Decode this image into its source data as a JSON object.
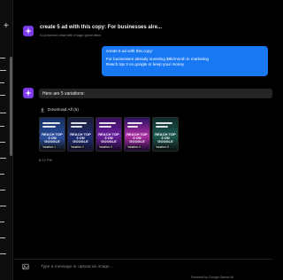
{
  "header": {
    "title": "create 5 ad with this copy: For businesses alre...",
    "subtitle": "AI-powered chat with image generation"
  },
  "user_message": {
    "line1": "create 5 ad with this copy:",
    "line2": "For businesses already investing $9k/month in marketing",
    "line3": "Reach top 3 on google or keep your money"
  },
  "assistant": {
    "message": "Here are 5 variations:",
    "download_label": "Download All (5)",
    "time": "8:12 PM"
  },
  "cards": [
    {
      "label": "Variation 1",
      "headline": "REACH TOP 3 ON GOOGLE"
    },
    {
      "label": "Variation 2",
      "headline": "REACH TOP 3 ON GOOGLE"
    },
    {
      "label": "Variation 3",
      "headline": "REACH TOP 3 ON GOOGLE"
    },
    {
      "label": "Variation 4",
      "headline": "REACH TOP 3 ON GOOGLE"
    },
    {
      "label": "Variation 5",
      "headline": "REACH TOP 3 ON GOOGLE"
    }
  ],
  "input": {
    "placeholder": "Type a message or upload an image..."
  },
  "footer": {
    "powered": "Powered by Google Gemini AI"
  },
  "colors": {
    "accent": "#7c3aed",
    "user_bubble": "#1877f2",
    "background": "#000000"
  },
  "icons": [
    "plus-icon",
    "sparkle-icon",
    "download-icon",
    "attach-image-icon"
  ]
}
